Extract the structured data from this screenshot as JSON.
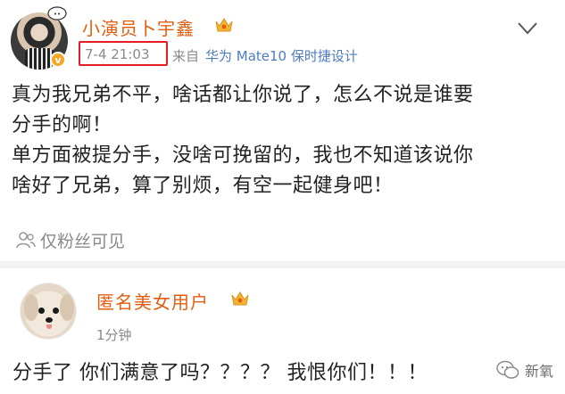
{
  "post": {
    "username": "小演员卜宇鑫",
    "time": "7-4 21:03",
    "from_label": "来自",
    "device": "华为 Mate10 保时捷设计",
    "text_lines": [
      "真为我兄弟不平，啥话都让你说了，怎么不说是谁要",
      "分手的啊！",
      "单方面被提分手，没啥可挽留的，我也不知道该说你",
      "啥好了兄弟，算了别烦，有空一起健身吧！"
    ],
    "visibility": "仅粉丝可见"
  },
  "comment": {
    "username": "匿名美女用户",
    "time": "1分钟",
    "text": "分手了 你们满意了吗？？？？ 我恨你们！！！"
  },
  "watermark": {
    "text": "新氧"
  },
  "colors": {
    "username": "#e35d0d",
    "link": "#4d7cbf",
    "meta": "#8a8a8a",
    "highlight_box": "#e51c23"
  }
}
